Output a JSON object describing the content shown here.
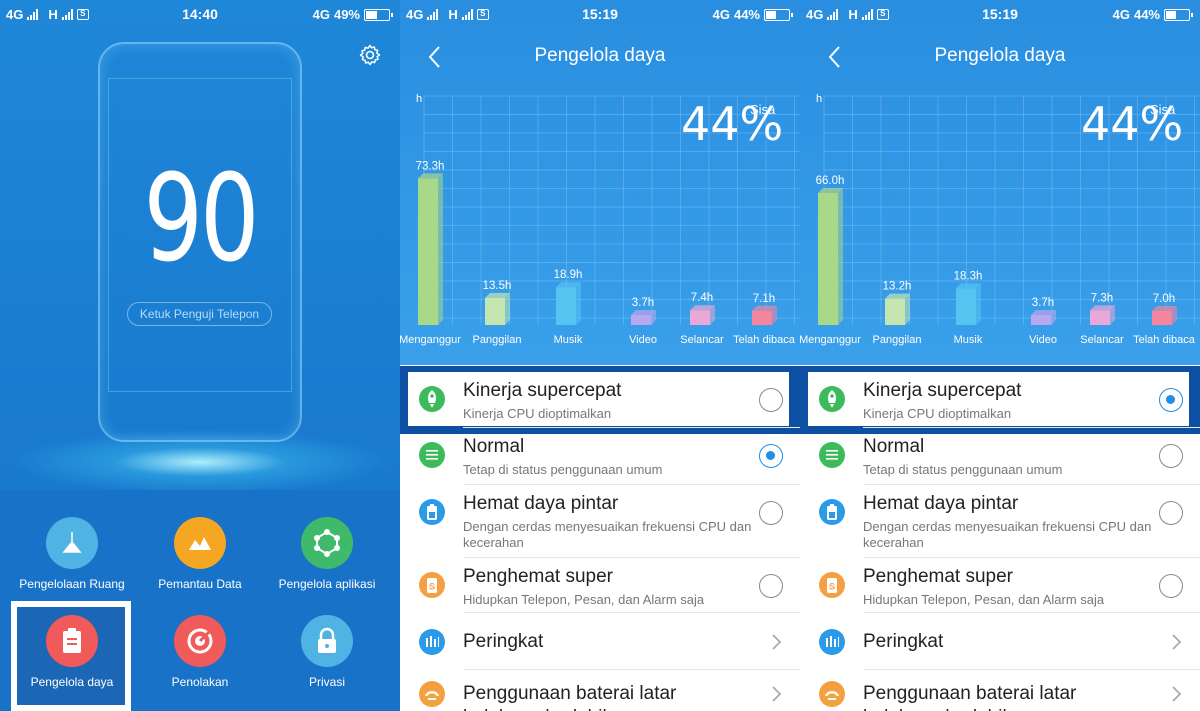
{
  "panel1": {
    "status": {
      "net1": "4G",
      "net2": "H",
      "time": "14:40",
      "net3": "4G",
      "battery": "49%",
      "battery_level": 0.49
    },
    "score": "90",
    "test_button": "Ketuk Penguji Telepon",
    "tiles": [
      {
        "label": "Pengelolaan Ruang",
        "color": "#4fb3e4",
        "icon": "broom-icon"
      },
      {
        "label": "Pemantau Data",
        "color": "#f5a623",
        "icon": "data-chart-icon"
      },
      {
        "label": "Pengelola aplikasi",
        "color": "#3fba6a",
        "icon": "app-network-icon"
      },
      {
        "label": "Pengelola daya",
        "color": "#f05a5a",
        "icon": "battery-clipboard-icon"
      },
      {
        "label": "Penolakan",
        "color": "#f05a5a",
        "icon": "block-target-icon"
      },
      {
        "label": "Privasi",
        "color": "#4fb3e4",
        "icon": "lock-icon"
      }
    ]
  },
  "panel2": {
    "status": {
      "net1": "4G",
      "net2": "H",
      "time": "15:19",
      "net3": "4G",
      "battery": "44%",
      "battery_level": 0.44
    },
    "title": "Pengelola daya",
    "percent": "44%",
    "remaining": "Sisa",
    "unit": "h",
    "chart_data": {
      "type": "bar",
      "categories": [
        "Menganggur",
        "Panggilan",
        "Musik",
        "Video",
        "Selancar",
        "Telah dibaca"
      ],
      "values": [
        73.3,
        13.5,
        18.9,
        3.7,
        7.4,
        7.1
      ],
      "value_labels": [
        "73.3h",
        "13.5h",
        "18.9h",
        "3.7h",
        "7.4h",
        "7.1h"
      ],
      "colors": [
        "#a8d989",
        "#c5e6b0",
        "#55c4f0",
        "#b9a7f0",
        "#e9a8d6",
        "#f5859e"
      ],
      "ylabel": "h"
    },
    "options": [
      {
        "title": "Kinerja supercepat",
        "sub": "Kinerja CPU dioptimalkan",
        "selected": false
      },
      {
        "title": "Normal",
        "sub": "Tetap di status penggunaan umum",
        "selected": true
      },
      {
        "title": "Hemat daya pintar",
        "sub": "Dengan cerdas menyesuaikan frekuensi CPU dan kecerahan",
        "selected": false
      },
      {
        "title": "Penghemat super",
        "sub": "Hidupkan Telepon, Pesan, dan Alarm saja",
        "selected": false
      }
    ],
    "links": [
      {
        "title": "Peringkat"
      },
      {
        "title": "Penggunaan baterai latar belakang berlebih"
      }
    ]
  },
  "panel3": {
    "status": {
      "net1": "4G",
      "net2": "H",
      "time": "15:19",
      "net3": "4G",
      "battery": "44%",
      "battery_level": 0.44
    },
    "title": "Pengelola daya",
    "percent": "44%",
    "remaining": "Sisa",
    "unit": "h",
    "chart_data": {
      "type": "bar",
      "categories": [
        "Menganggur",
        "Panggilan",
        "Musik",
        "Video",
        "Selancar",
        "Telah dibaca"
      ],
      "values": [
        66.0,
        13.2,
        18.3,
        3.7,
        7.3,
        7.0
      ],
      "value_labels": [
        "66.0h",
        "13.2h",
        "18.3h",
        "3.7h",
        "7.3h",
        "7.0h"
      ],
      "colors": [
        "#a8d989",
        "#c5e6b0",
        "#55c4f0",
        "#b9a7f0",
        "#e9a8d6",
        "#f5859e"
      ],
      "ylabel": "h"
    },
    "options": [
      {
        "title": "Kinerja supercepat",
        "sub": "Kinerja CPU dioptimalkan",
        "selected": true
      },
      {
        "title": "Normal",
        "sub": "Tetap di status penggunaan umum",
        "selected": false
      },
      {
        "title": "Hemat daya pintar",
        "sub": "Dengan cerdas menyesuaikan frekuensi CPU dan kecerahan",
        "selected": false
      },
      {
        "title": "Penghemat super",
        "sub": "Hidupkan Telepon, Pesan, dan Alarm saja",
        "selected": false
      }
    ],
    "links": [
      {
        "title": "Peringkat"
      },
      {
        "title": "Penggunaan baterai latar belakang berlebih"
      }
    ]
  },
  "option_icons": [
    {
      "icon": "rocket-icon",
      "color": "#3dbb5c"
    },
    {
      "icon": "list-icon",
      "color": "#3dbb5c"
    },
    {
      "icon": "battery-smart-icon",
      "color": "#2b9be8"
    },
    {
      "icon": "power-save-icon",
      "color": "#f5a040"
    },
    {
      "icon": "bar-chart-icon",
      "color": "#2b9be8"
    },
    {
      "icon": "background-battery-icon",
      "color": "#f5a040"
    }
  ]
}
